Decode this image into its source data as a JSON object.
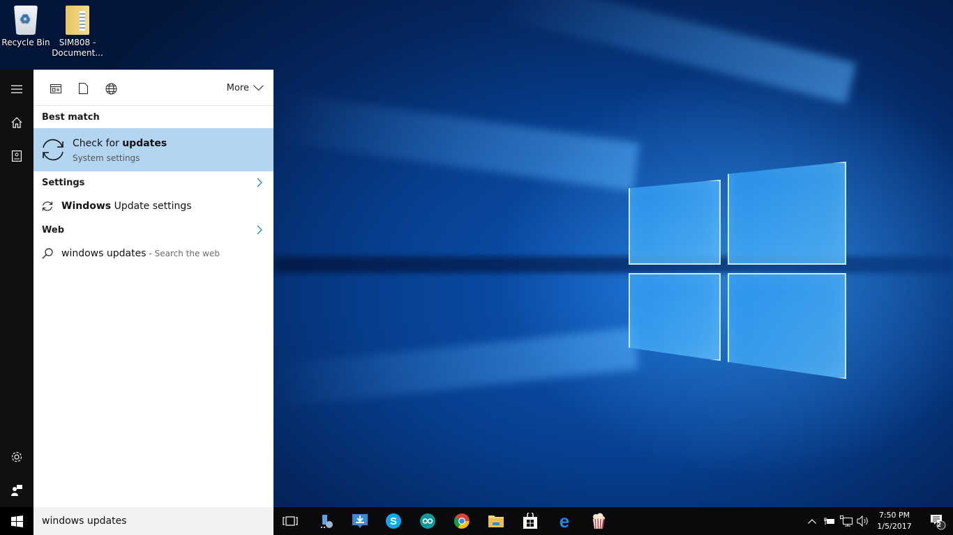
{
  "desktop": {
    "icons": [
      {
        "label": "Recycle Bin"
      },
      {
        "label_line1": "SIM808 -",
        "label_line2": "Document..."
      }
    ]
  },
  "start_rail": {
    "items": [
      {
        "name": "menu",
        "icon": "hamburger-icon"
      },
      {
        "name": "home",
        "icon": "home-icon"
      },
      {
        "name": "notebook",
        "icon": "notebook-icon"
      },
      {
        "name": "settings",
        "icon": "gear-icon"
      },
      {
        "name": "feedback",
        "icon": "feedback-icon"
      }
    ]
  },
  "search_panel": {
    "filters": [
      {
        "name": "apps",
        "icon": "apps-filter-icon"
      },
      {
        "name": "documents",
        "icon": "document-filter-icon"
      },
      {
        "name": "web",
        "icon": "globe-icon"
      }
    ],
    "more_label": "More",
    "best_match_heading": "Best match",
    "best_match": {
      "title_prefix": "Check for ",
      "title_bold": "updates",
      "subtitle": "System settings",
      "icon": "sync-icon"
    },
    "settings_heading": "Settings",
    "settings_items": [
      {
        "bold": "Windows",
        "rest": " Update settings",
        "icon": "sync-icon"
      }
    ],
    "web_heading": "Web",
    "web_items": [
      {
        "query": "windows updates",
        "hint": "- Search the web",
        "icon": "search-icon"
      }
    ]
  },
  "search_box": {
    "value": "windows updates"
  },
  "taskbar": {
    "apps": [
      {
        "name": "task-view",
        "icon": "task-view-icon"
      },
      {
        "name": "network-app",
        "icon": "network-app-icon"
      },
      {
        "name": "downloader",
        "icon": "download-icon"
      },
      {
        "name": "skype",
        "icon": "skype-icon"
      },
      {
        "name": "arduino",
        "icon": "arduino-icon"
      },
      {
        "name": "chrome",
        "icon": "chrome-icon"
      },
      {
        "name": "file-explorer",
        "icon": "folder-icon"
      },
      {
        "name": "store",
        "icon": "store-icon"
      },
      {
        "name": "edge",
        "icon": "edge-icon"
      },
      {
        "name": "popcorn-time",
        "icon": "popcorn-icon"
      }
    ],
    "tray": {
      "time": "7:50 PM",
      "date": "1/5/2017",
      "notification_count": "2"
    }
  },
  "colors": {
    "selected_result": "#b3d5f1",
    "accent": "#1e88d0",
    "taskbar": "#0a0a0c"
  }
}
